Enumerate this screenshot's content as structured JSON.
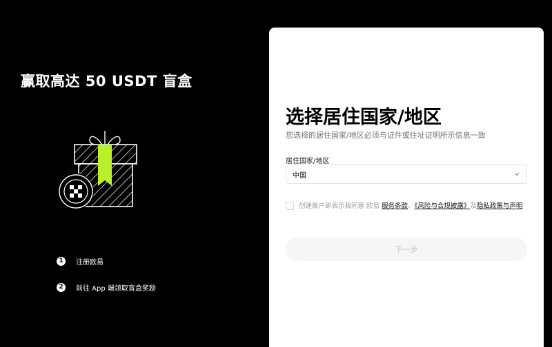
{
  "promo": {
    "title": "赢取高达 50 USDT 盲盒",
    "steps": [
      {
        "number": "1",
        "label": "注册欧易"
      },
      {
        "number": "2",
        "label": "前往 App 端领取盲盒奖励"
      }
    ]
  },
  "form": {
    "title": "选择居住国家/地区",
    "subtitle": "您选择的居住国家/地区必须与证件或住址证明所示信息一致",
    "country_label": "居住国家/地区",
    "country_value": "中国",
    "agreement": {
      "prefix": "创建账户即表示我同意 欧易 ",
      "terms_link": "服务条款",
      "sep1": "、",
      "risk_link": "《风险与合规披露》",
      "sep2": "及",
      "privacy_link": "隐私政策与声明"
    },
    "next_label": "下一步"
  },
  "colors": {
    "brand_green": "#b8f02e",
    "background": "#000000",
    "card": "#ffffff"
  }
}
